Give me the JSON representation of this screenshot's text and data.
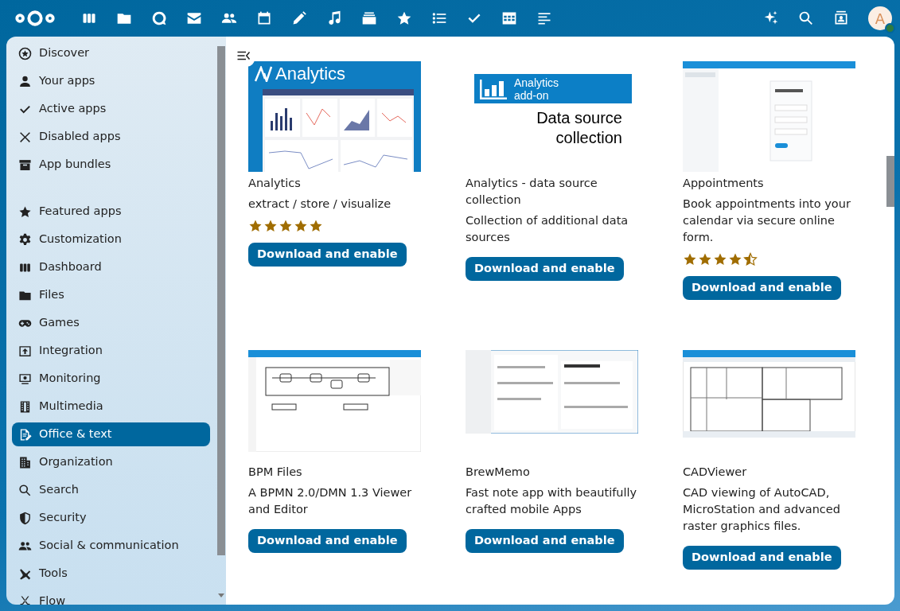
{
  "header": {
    "avatar": {
      "initial": "A",
      "online": true
    }
  },
  "sidebar": {
    "groups": [
      {
        "items": [
          {
            "label": "Discover",
            "selected": false
          },
          {
            "label": "Your apps",
            "selected": false
          },
          {
            "label": "Active apps",
            "selected": false
          },
          {
            "label": "Disabled apps",
            "selected": false
          },
          {
            "label": "App bundles",
            "selected": false
          }
        ]
      },
      {
        "items": [
          {
            "label": "Featured apps",
            "selected": false
          },
          {
            "label": "Customization",
            "selected": false
          },
          {
            "label": "Dashboard",
            "selected": false
          },
          {
            "label": "Files",
            "selected": false
          },
          {
            "label": "Games",
            "selected": false
          },
          {
            "label": "Integration",
            "selected": false
          },
          {
            "label": "Monitoring",
            "selected": false
          },
          {
            "label": "Multimedia",
            "selected": false
          },
          {
            "label": "Office & text",
            "selected": true
          },
          {
            "label": "Organization",
            "selected": false
          },
          {
            "label": "Search",
            "selected": false
          },
          {
            "label": "Security",
            "selected": false
          },
          {
            "label": "Social & communication",
            "selected": false
          },
          {
            "label": "Tools",
            "selected": false
          },
          {
            "label": "Flow",
            "selected": false
          }
        ]
      }
    ]
  },
  "apps": [
    {
      "name": "Analytics",
      "summary": "extract / store / visualize",
      "stars": 5,
      "button": "Download and enable",
      "image": {
        "kind": "logo-banner",
        "title": "Analytics"
      }
    },
    {
      "name": "Analytics - data source collection",
      "summary": "Collection of additional data sources",
      "button": "Download and enable",
      "image": {
        "kind": "addon-banner",
        "badge_lines": [
          "Analytics",
          "add-on"
        ],
        "caption_lines": [
          "Data source",
          "collection"
        ]
      }
    },
    {
      "name": "Appointments",
      "summary": "Book appointments into your calendar via secure online form.",
      "stars": 4.5,
      "button": "Download and enable"
    },
    {
      "name": "BPM Files",
      "summary": "A BPMN 2.0/DMN 1.3 Viewer and Editor",
      "button": "Download and enable"
    },
    {
      "name": "BrewMemo",
      "summary": "Fast note app with beautifully crafted mobile Apps",
      "button": "Download and enable"
    },
    {
      "name": "CADViewer",
      "summary": "CAD viewing of AutoCAD, MicroStation and advanced raster graphics files.",
      "button": "Download and enable"
    }
  ]
}
